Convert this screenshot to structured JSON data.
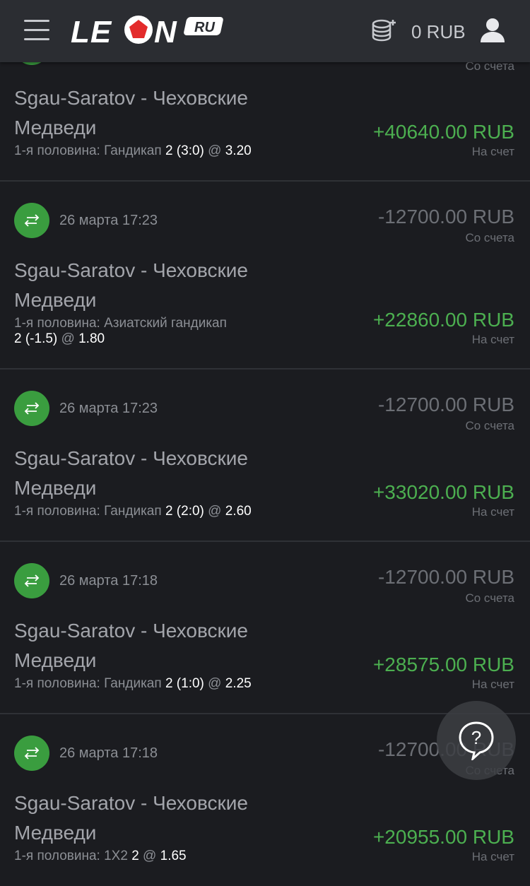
{
  "header": {
    "logo_text": "LEON",
    "logo_suffix": "RU",
    "balance": "0 RUB"
  },
  "top_partial": {
    "debit_label": "Со счета",
    "match_line1": "Sgau-Saratov - Чеховские",
    "match_line2": "Медведи",
    "market": "1-я половина: Гандикап",
    "selection": "2 (3:0)",
    "at": "@",
    "odds": "3.20",
    "credit": "+40640.00 RUB",
    "credit_label": "На счет"
  },
  "items": [
    {
      "date": "26 марта 17:23",
      "debit": "-12700.00 RUB",
      "debit_label": "Со счета",
      "match_line1": "Sgau-Saratov - Чеховские",
      "match_line2": "Медведи",
      "market": "1-я половина: Азиатский гандикап",
      "selection": "2 (-1.5)",
      "at": "@",
      "odds": "1.80",
      "credit": "+22860.00 RUB",
      "credit_label": "На счет"
    },
    {
      "date": "26 марта 17:23",
      "debit": "-12700.00 RUB",
      "debit_label": "Со счета",
      "match_line1": "Sgau-Saratov - Чеховские",
      "match_line2": "Медведи",
      "market": "1-я половина: Гандикап",
      "selection": "2 (2:0)",
      "at": "@",
      "odds": "2.60",
      "credit": "+33020.00 RUB",
      "credit_label": "На счет"
    },
    {
      "date": "26 марта 17:18",
      "debit": "-12700.00 RUB",
      "debit_label": "Со счета",
      "match_line1": "Sgau-Saratov - Чеховские",
      "match_line2": "Медведи",
      "market": "1-я половина: Гандикап",
      "selection": "2 (1:0)",
      "at": "@",
      "odds": "2.25",
      "credit": "+28575.00 RUB",
      "credit_label": "На счет"
    },
    {
      "date": "26 марта 17:18",
      "debit": "-12700.00 RUB",
      "debit_label": "Со счета",
      "match_line1": "Sgau-Saratov - Чеховские",
      "match_line2": "Медведи",
      "market": "1-я половина: 1X2",
      "selection": "2",
      "at": "@",
      "odds": "1.65",
      "credit": "+20955.00 RUB",
      "credit_label": "На счет"
    }
  ],
  "help_button": {
    "symbol": "?"
  },
  "colors": {
    "accent_green": "#3a9d3f",
    "credit_green": "#4caf50",
    "logo_red": "#e32b2b",
    "background": "#1b1c20",
    "header": "#2b2d32"
  },
  "icons": [
    "menu-icon",
    "coins-icon",
    "user-icon",
    "transfer-icon",
    "help-chat-icon"
  ]
}
